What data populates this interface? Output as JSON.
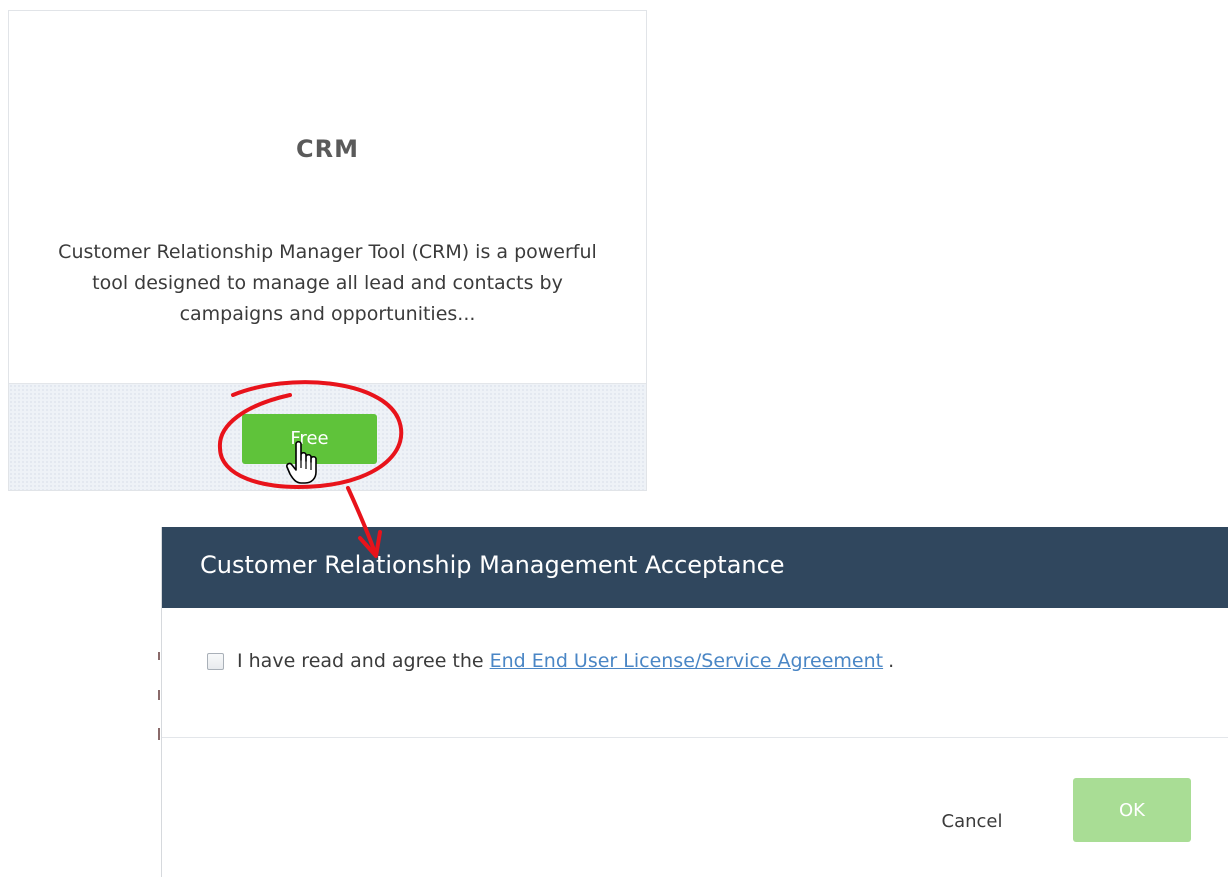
{
  "app_card": {
    "logo_text": "CRM",
    "description": "Customer Relationship Manager Tool (CRM) is a powerful tool designed to manage all lead and contacts by campaigns and opportunities...",
    "free_button_label": "Free"
  },
  "dialog": {
    "title": "Customer Relationship Management Acceptance",
    "agreement_prefix": "I have read and agree the",
    "agreement_link": "End End User License/Service Agreement",
    "agreement_suffix": ".",
    "agreement_checked": false,
    "cancel_label": "Cancel",
    "ok_label": "OK",
    "ok_enabled": false
  },
  "colors": {
    "header_background": "#30475e",
    "free_button": "#5fc33a",
    "ok_button_disabled": "#a9dd95",
    "link": "#4a86c5",
    "annotation": "#e8131b"
  },
  "icons": {
    "cursor": "hand-pointer-icon"
  }
}
